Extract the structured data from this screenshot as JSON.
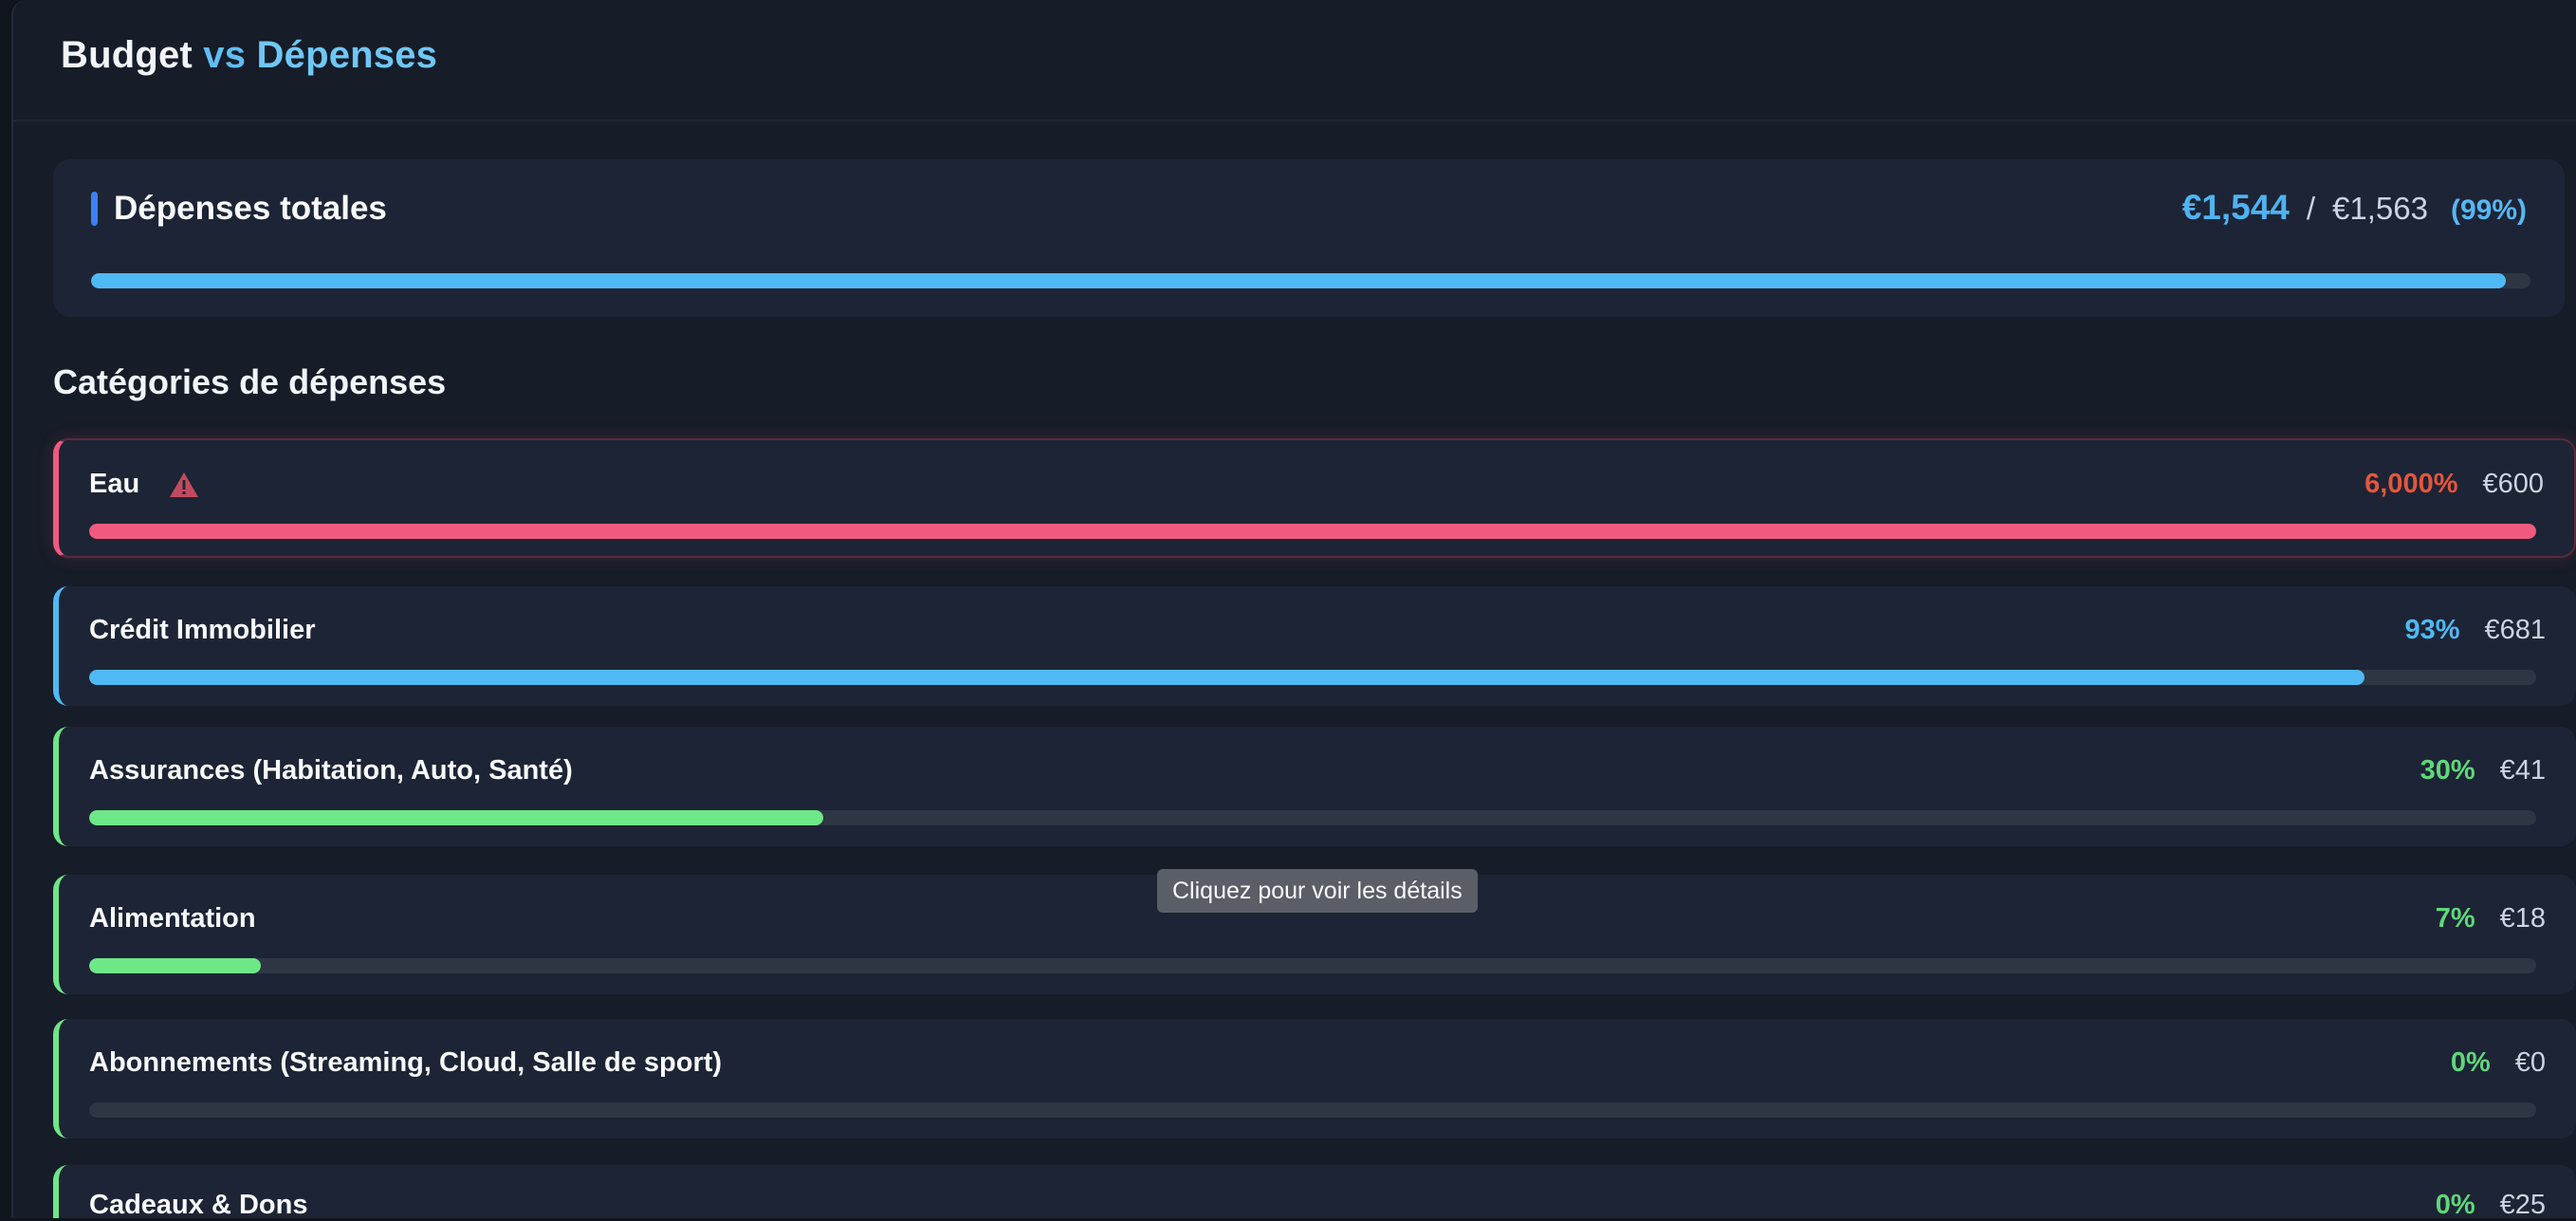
{
  "header": {
    "title_part1": "Budget",
    "title_part2": "vs",
    "title_part3": "Dépenses"
  },
  "total": {
    "label": "Dépenses totales",
    "spent": "€1,544",
    "separator": "/",
    "budget": "€1,563",
    "percent_label": "(99%)",
    "progress_fraction": 0.99,
    "bar_color": "#4fb9f3"
  },
  "categories_section": {
    "title": "Catégories de dépenses",
    "items": [
      {
        "name": "Eau",
        "percent": "6,000%",
        "amount": "€600",
        "progress_fraction": 1.0,
        "status": "over",
        "accent_color": "#f05a7e",
        "percent_color": "#e4563d",
        "warning_icon": "warning-triangle-icon"
      },
      {
        "name": "Crédit Immobilier",
        "percent": "93%",
        "amount": "€681",
        "progress_fraction": 0.93,
        "status": "near",
        "accent_color": "#4fb9f3",
        "percent_color": "#4fb9f3"
      },
      {
        "name": "Assurances (Habitation, Auto, Santé)",
        "percent": "30%",
        "amount": "€41",
        "progress_fraction": 0.3,
        "status": "ok",
        "accent_color": "#6ee787",
        "percent_color": "#5fd77a"
      },
      {
        "name": "Alimentation",
        "percent": "7%",
        "amount": "€18",
        "progress_fraction": 0.07,
        "status": "ok",
        "accent_color": "#6ee787",
        "percent_color": "#5fd77a"
      },
      {
        "name": "Abonnements (Streaming, Cloud, Salle de sport)",
        "percent": "0%",
        "amount": "€0",
        "progress_fraction": 0.0,
        "status": "ok",
        "accent_color": "#6ee787",
        "percent_color": "#5fd77a"
      },
      {
        "name": "Cadeaux & Dons",
        "percent": "0%",
        "amount": "€25",
        "progress_fraction": 0.0,
        "status": "ok",
        "accent_color": "#6ee787",
        "percent_color": "#5fd77a"
      }
    ]
  },
  "tooltip": {
    "text": "Cliquez pour voir les détails"
  }
}
